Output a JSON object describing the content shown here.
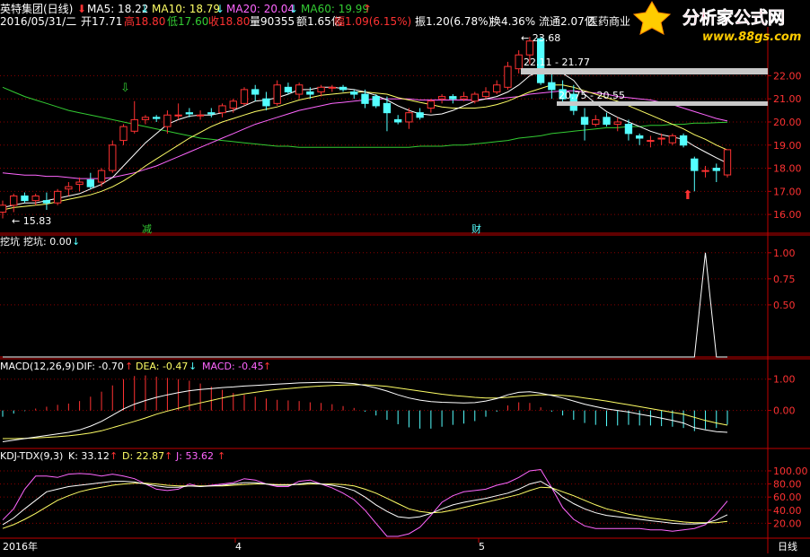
{
  "header": {
    "stock_name": "英特集团(日线)",
    "ma5_label": "MA5: 18.22",
    "ma10_label": "MA10: 18.79",
    "ma20_label": "MA20: 20.04",
    "ma60_label": "MA60: 19.99",
    "date": "2016/05/31/二",
    "open": "开17.71",
    "high": "高18.80",
    "low": "低17.60",
    "close": "收18.80",
    "volume": "量90355",
    "amount": "额1.65亿",
    "change": "幅1.09(6.15%)",
    "amplitude": "振1.20(6.78%)",
    "turnover": "换4.36%",
    "float": "流通2.07亿",
    "sector": "医药商业"
  },
  "logo": {
    "title": "分析家公式网",
    "url": "www.88gs.com"
  },
  "colors": {
    "up": "#ff3232",
    "down": "#54ffff",
    "ma5": "#ffffff",
    "ma10": "#ffff66",
    "ma20": "#ff66ff",
    "ma60": "#33cc33",
    "grid": "#8b0000",
    "axis": "#c00000",
    "dif": "#ffffff",
    "dea": "#ffff66",
    "k": "#ffffff",
    "d": "#ffff66",
    "j": "#ff66ff"
  },
  "annotations": {
    "low_label": "15.83",
    "high_label": "23.68",
    "zone1": "22.11 - 21.77",
    "zone2": "20.75 - 20.55",
    "event1": "减",
    "event2": "财"
  },
  "panels": {
    "wakeng_title": "挖坑",
    "wakeng_value": "挖坑: 0.00",
    "macd_title": "MACD(12,26,9)",
    "macd_dif": "DIF: -0.70",
    "macd_dea": "DEA: -0.47",
    "macd_macd": "MACD: -0.45",
    "kdj_title": "KDJ-TDX(9,3)",
    "kdj_k": "K: 33.12",
    "kdj_d": "D: 22.87",
    "kdj_j": "J: 53.62"
  },
  "xaxis": {
    "labels": [
      "2016年",
      "4",
      "5"
    ],
    "period": "日线"
  },
  "chart_data": [
    {
      "type": "candlestick",
      "ylim": [
        15.5,
        23.8
      ],
      "yticks": [
        "22.00",
        "21.00",
        "20.00",
        "19.00",
        "18.00",
        "17.00",
        "16.00"
      ],
      "candles": [
        [
          16.1,
          16.6,
          15.83,
          16.4
        ],
        [
          16.4,
          16.9,
          16.1,
          16.8
        ],
        [
          16.8,
          16.95,
          16.5,
          16.6
        ],
        [
          16.6,
          16.9,
          16.4,
          16.8
        ],
        [
          16.6,
          16.95,
          16.2,
          16.5
        ],
        [
          16.5,
          17.1,
          16.4,
          17.0
        ],
        [
          17.1,
          17.4,
          16.8,
          17.2
        ],
        [
          17.3,
          17.6,
          17.0,
          17.4
        ],
        [
          17.5,
          17.8,
          17.1,
          17.2
        ],
        [
          17.4,
          18.0,
          17.2,
          17.9
        ],
        [
          17.9,
          19.2,
          17.8,
          19.0
        ],
        [
          19.2,
          19.9,
          19.0,
          19.8
        ],
        [
          19.6,
          20.9,
          19.5,
          20.1
        ],
        [
          20.1,
          20.3,
          19.9,
          20.2
        ],
        [
          20.2,
          20.3,
          20.0,
          20.15
        ],
        [
          19.8,
          20.5,
          19.5,
          20.3
        ],
        [
          20.3,
          20.8,
          20.1,
          20.3
        ],
        [
          20.4,
          20.6,
          20.2,
          20.35
        ],
        [
          20.3,
          20.5,
          20.1,
          20.3
        ],
        [
          20.4,
          20.6,
          20.2,
          20.35
        ],
        [
          20.4,
          20.8,
          20.2,
          20.7
        ],
        [
          20.6,
          21.0,
          20.4,
          20.9
        ],
        [
          20.8,
          21.5,
          20.7,
          21.4
        ],
        [
          21.4,
          21.6,
          20.9,
          21.2
        ],
        [
          21.0,
          21.3,
          20.5,
          20.7
        ],
        [
          20.8,
          21.8,
          20.7,
          21.6
        ],
        [
          21.5,
          21.7,
          21.2,
          21.3
        ],
        [
          21.2,
          21.7,
          21.0,
          21.6
        ],
        [
          21.3,
          21.5,
          21.0,
          21.2
        ],
        [
          21.3,
          21.6,
          21.1,
          21.5
        ],
        [
          21.5,
          21.6,
          21.3,
          21.5
        ],
        [
          21.5,
          21.6,
          21.3,
          21.4
        ],
        [
          21.3,
          21.4,
          21.0,
          21.2
        ],
        [
          21.2,
          21.4,
          20.6,
          20.8
        ],
        [
          21.1,
          21.2,
          20.6,
          20.7
        ],
        [
          20.8,
          21.1,
          19.6,
          20.4
        ],
        [
          20.1,
          20.3,
          19.9,
          20.0
        ],
        [
          20.0,
          20.6,
          19.7,
          20.4
        ],
        [
          20.4,
          20.6,
          20.1,
          20.2
        ],
        [
          20.6,
          21.0,
          20.4,
          20.9
        ],
        [
          21.0,
          21.2,
          20.8,
          21.1
        ],
        [
          21.1,
          21.2,
          20.8,
          21.0
        ],
        [
          21.0,
          21.3,
          20.9,
          21.1
        ],
        [
          20.9,
          21.3,
          20.8,
          21.2
        ],
        [
          21.1,
          21.5,
          21.0,
          21.3
        ],
        [
          21.3,
          21.8,
          21.2,
          21.6
        ],
        [
          21.5,
          22.6,
          21.4,
          22.4
        ],
        [
          22.3,
          23.1,
          22.1,
          22.9
        ],
        [
          22.9,
          23.68,
          22.5,
          23.5
        ],
        [
          23.6,
          23.7,
          21.6,
          21.7
        ],
        [
          21.7,
          22.1,
          21.0,
          21.4
        ],
        [
          21.4,
          21.8,
          20.8,
          21.0
        ],
        [
          21.2,
          21.6,
          20.3,
          20.5
        ],
        [
          20.2,
          20.6,
          19.2,
          19.9
        ],
        [
          19.9,
          20.3,
          19.8,
          20.1
        ],
        [
          20.2,
          20.4,
          19.8,
          19.9
        ],
        [
          19.9,
          20.2,
          19.6,
          20.0
        ],
        [
          19.9,
          20.1,
          19.2,
          19.5
        ],
        [
          19.4,
          19.5,
          19.0,
          19.3
        ],
        [
          19.2,
          19.4,
          18.9,
          19.2
        ],
        [
          19.3,
          19.5,
          19.0,
          19.3
        ],
        [
          19.1,
          19.5,
          19.0,
          19.4
        ],
        [
          19.4,
          19.5,
          18.9,
          19.0
        ],
        [
          18.4,
          18.5,
          17.0,
          17.9
        ],
        [
          17.9,
          18.1,
          17.6,
          17.9
        ],
        [
          18.0,
          18.2,
          17.4,
          17.9
        ],
        [
          17.71,
          18.8,
          17.6,
          18.8
        ]
      ],
      "ma5": [
        16.3,
        16.4,
        16.5,
        16.5,
        16.6,
        16.7,
        16.8,
        16.9,
        17.1,
        17.3,
        17.6,
        18.1,
        18.6,
        19.1,
        19.5,
        19.9,
        20.1,
        20.25,
        20.3,
        20.3,
        20.4,
        20.5,
        20.7,
        20.9,
        20.95,
        21.05,
        21.2,
        21.4,
        21.4,
        21.5,
        21.5,
        21.45,
        21.4,
        21.3,
        21.15,
        20.95,
        20.7,
        20.5,
        20.35,
        20.3,
        20.35,
        20.5,
        20.7,
        20.9,
        21.0,
        21.1,
        21.3,
        21.6,
        22.0,
        22.2,
        22.3,
        22.1,
        21.8,
        21.2,
        20.8,
        20.45,
        20.2,
        20.0,
        19.8,
        19.6,
        19.45,
        19.35,
        19.25,
        18.95,
        18.7,
        18.45,
        18.22
      ],
      "ma10": [
        16.2,
        16.3,
        16.35,
        16.4,
        16.45,
        16.55,
        16.65,
        16.75,
        16.85,
        17.0,
        17.2,
        17.45,
        17.75,
        18.1,
        18.4,
        18.7,
        19.0,
        19.3,
        19.55,
        19.8,
        20.0,
        20.15,
        20.3,
        20.45,
        20.55,
        20.65,
        20.8,
        20.95,
        21.05,
        21.15,
        21.2,
        21.25,
        21.3,
        21.3,
        21.25,
        21.2,
        21.05,
        20.95,
        20.85,
        20.75,
        20.65,
        20.6,
        20.6,
        20.6,
        20.65,
        20.75,
        20.9,
        21.1,
        21.3,
        21.45,
        21.6,
        21.6,
        21.5,
        21.35,
        21.2,
        21.05,
        20.9,
        20.7,
        20.5,
        20.3,
        20.1,
        19.9,
        19.7,
        19.45,
        19.25,
        19.0,
        18.79
      ],
      "ma20": [
        17.8,
        17.75,
        17.7,
        17.7,
        17.65,
        17.65,
        17.6,
        17.55,
        17.55,
        17.55,
        17.6,
        17.7,
        17.8,
        17.95,
        18.1,
        18.3,
        18.5,
        18.7,
        18.9,
        19.1,
        19.3,
        19.5,
        19.7,
        19.9,
        20.05,
        20.2,
        20.35,
        20.5,
        20.6,
        20.7,
        20.8,
        20.85,
        20.9,
        20.95,
        21.0,
        21.0,
        21.0,
        21.0,
        20.95,
        20.95,
        20.95,
        20.95,
        20.95,
        20.95,
        21.0,
        21.0,
        21.05,
        21.1,
        21.2,
        21.25,
        21.3,
        21.35,
        21.35,
        21.3,
        21.25,
        21.2,
        21.1,
        21.05,
        21.0,
        20.95,
        20.85,
        20.75,
        20.6,
        20.45,
        20.3,
        20.15,
        20.04
      ],
      "ma60": [
        21.5,
        21.3,
        21.1,
        20.95,
        20.8,
        20.65,
        20.5,
        20.4,
        20.3,
        20.2,
        20.1,
        20.0,
        19.9,
        19.8,
        19.7,
        19.6,
        19.5,
        19.4,
        19.3,
        19.25,
        19.2,
        19.15,
        19.1,
        19.05,
        19.0,
        18.95,
        18.95,
        18.9,
        18.9,
        18.9,
        18.9,
        18.9,
        18.9,
        18.9,
        18.9,
        18.9,
        18.9,
        18.9,
        18.95,
        18.95,
        18.95,
        19.0,
        19.0,
        19.05,
        19.1,
        19.15,
        19.2,
        19.3,
        19.35,
        19.4,
        19.5,
        19.55,
        19.6,
        19.65,
        19.7,
        19.75,
        19.75,
        19.8,
        19.8,
        19.85,
        19.85,
        19.9,
        19.9,
        19.95,
        19.95,
        19.97,
        19.99
      ]
    },
    {
      "type": "line",
      "title": "挖坑",
      "ylim": [
        0,
        1.05
      ],
      "yticks": [
        "1.00",
        "0.75",
        "0.50"
      ],
      "values": [
        0,
        0,
        0,
        0,
        0,
        0,
        0,
        0,
        0,
        0,
        0,
        0,
        0,
        0,
        0,
        0,
        0,
        0,
        0,
        0,
        0,
        0,
        0,
        0,
        0,
        0,
        0,
        0,
        0,
        0,
        0,
        0,
        0,
        0,
        0,
        0,
        0,
        0,
        0,
        0,
        0,
        0,
        0,
        0,
        0,
        0,
        0,
        0,
        0,
        0,
        0,
        0,
        0,
        0,
        0,
        0,
        0,
        0,
        0,
        0,
        0,
        0,
        0,
        0,
        1,
        0,
        0
      ]
    },
    {
      "type": "bar",
      "title": "MACD(12,26,9)",
      "ylim": [
        -1.1,
        1.25
      ],
      "yticks": [
        "1.00",
        "0.00"
      ],
      "dif": [
        -1.0,
        -0.95,
        -0.9,
        -0.85,
        -0.8,
        -0.75,
        -0.7,
        -0.62,
        -0.5,
        -0.35,
        -0.15,
        0.05,
        0.2,
        0.32,
        0.42,
        0.5,
        0.57,
        0.63,
        0.67,
        0.7,
        0.73,
        0.75,
        0.78,
        0.8,
        0.82,
        0.84,
        0.86,
        0.88,
        0.89,
        0.9,
        0.9,
        0.88,
        0.86,
        0.8,
        0.72,
        0.62,
        0.5,
        0.4,
        0.33,
        0.28,
        0.26,
        0.25,
        0.24,
        0.25,
        0.3,
        0.38,
        0.5,
        0.58,
        0.6,
        0.55,
        0.48,
        0.4,
        0.3,
        0.2,
        0.12,
        0.05,
        0.0,
        -0.05,
        -0.12,
        -0.18,
        -0.25,
        -0.32,
        -0.4,
        -0.55,
        -0.62,
        -0.68,
        -0.7
      ],
      "dea": [
        -0.9,
        -0.9,
        -0.89,
        -0.88,
        -0.86,
        -0.84,
        -0.81,
        -0.77,
        -0.72,
        -0.65,
        -0.55,
        -0.45,
        -0.35,
        -0.24,
        -0.12,
        -0.02,
        0.07,
        0.16,
        0.24,
        0.32,
        0.4,
        0.47,
        0.53,
        0.58,
        0.63,
        0.67,
        0.7,
        0.73,
        0.76,
        0.78,
        0.8,
        0.81,
        0.82,
        0.82,
        0.8,
        0.77,
        0.72,
        0.67,
        0.62,
        0.57,
        0.52,
        0.48,
        0.45,
        0.42,
        0.4,
        0.4,
        0.42,
        0.45,
        0.48,
        0.5,
        0.5,
        0.48,
        0.45,
        0.4,
        0.35,
        0.3,
        0.24,
        0.18,
        0.12,
        0.06,
        0.0,
        -0.06,
        -0.12,
        -0.22,
        -0.32,
        -0.4,
        -0.47
      ],
      "macd": [
        -0.2,
        -0.1,
        -0.02,
        0.06,
        0.12,
        0.18,
        0.22,
        0.3,
        0.44,
        0.6,
        0.8,
        1.0,
        1.1,
        1.12,
        1.08,
        1.04,
        1.0,
        0.95,
        0.86,
        0.76,
        0.66,
        0.56,
        0.5,
        0.44,
        0.38,
        0.34,
        0.32,
        0.3,
        0.26,
        0.24,
        0.2,
        0.14,
        0.08,
        -0.04,
        -0.16,
        -0.3,
        -0.44,
        -0.54,
        -0.58,
        -0.58,
        -0.52,
        -0.46,
        -0.42,
        -0.34,
        -0.2,
        -0.04,
        0.16,
        0.26,
        0.24,
        0.1,
        -0.04,
        -0.16,
        -0.3,
        -0.4,
        -0.46,
        -0.5,
        -0.48,
        -0.46,
        -0.48,
        -0.48,
        -0.5,
        -0.52,
        -0.56,
        -0.66,
        -0.6,
        -0.56,
        -0.45
      ]
    },
    {
      "type": "line",
      "title": "KDJ-TDX(9,3)",
      "ylim": [
        0,
        115
      ],
      "yticks": [
        "100.00",
        "80.00",
        "60.00",
        "40.00",
        "20.00"
      ],
      "k": [
        18,
        28,
        42,
        55,
        68,
        72,
        76,
        78,
        80,
        82,
        84,
        84,
        83,
        80,
        77,
        75,
        75,
        77,
        76,
        77,
        78,
        80,
        82,
        82,
        80,
        78,
        78,
        80,
        82,
        80,
        78,
        75,
        70,
        60,
        48,
        38,
        30,
        28,
        30,
        35,
        42,
        48,
        52,
        55,
        58,
        62,
        66,
        72,
        80,
        84,
        74,
        60,
        50,
        42,
        36,
        32,
        30,
        28,
        26,
        24,
        22,
        20,
        19,
        19,
        20,
        25,
        33
      ],
      "d": [
        12,
        18,
        26,
        35,
        45,
        55,
        62,
        68,
        72,
        75,
        78,
        80,
        81,
        81,
        80,
        78,
        77,
        77,
        77,
        77,
        77,
        78,
        79,
        80,
        80,
        79,
        79,
        79,
        80,
        80,
        80,
        79,
        77,
        72,
        66,
        58,
        50,
        42,
        38,
        36,
        37,
        40,
        44,
        48,
        52,
        56,
        60,
        64,
        70,
        75,
        74,
        68,
        62,
        55,
        48,
        42,
        38,
        34,
        31,
        28,
        26,
        24,
        22,
        21,
        21,
        21,
        23
      ],
      "j": [
        25,
        42,
        72,
        92,
        92,
        90,
        95,
        96,
        95,
        92,
        95,
        92,
        88,
        80,
        72,
        70,
        72,
        80,
        76,
        78,
        80,
        82,
        88,
        86,
        80,
        76,
        76,
        84,
        86,
        80,
        74,
        66,
        56,
        40,
        20,
        0,
        0,
        4,
        14,
        32,
        52,
        62,
        68,
        70,
        72,
        78,
        82,
        90,
        100,
        102,
        74,
        44,
        26,
        16,
        12,
        12,
        12,
        12,
        12,
        10,
        10,
        8,
        10,
        12,
        18,
        34,
        54
      ]
    }
  ]
}
